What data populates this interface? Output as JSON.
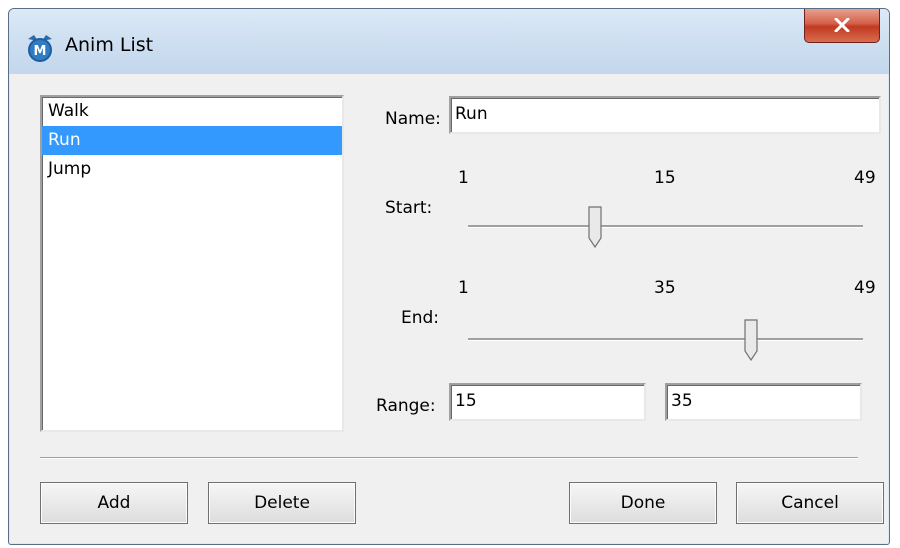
{
  "window": {
    "title": "Anim List"
  },
  "anim_list": {
    "items": [
      "Walk",
      "Run",
      "Jump"
    ],
    "selected": "Run"
  },
  "form": {
    "name_label": "Name:",
    "name_value": "Run",
    "start_label": "Start:",
    "start_slider": {
      "min": "1",
      "max": "49",
      "value": "15"
    },
    "end_label": "End:",
    "end_slider": {
      "min": "1",
      "max": "49",
      "value": "35"
    },
    "range_label": "Range:",
    "range_start": "15",
    "range_end": "35"
  },
  "buttons": {
    "add": "Add",
    "delete": "Delete",
    "done": "Done",
    "cancel": "Cancel"
  },
  "icons": {
    "app": "app-m-icon",
    "close": "close-icon"
  },
  "colors": {
    "selection": "#3399ff",
    "close_button": "#c23a20"
  }
}
